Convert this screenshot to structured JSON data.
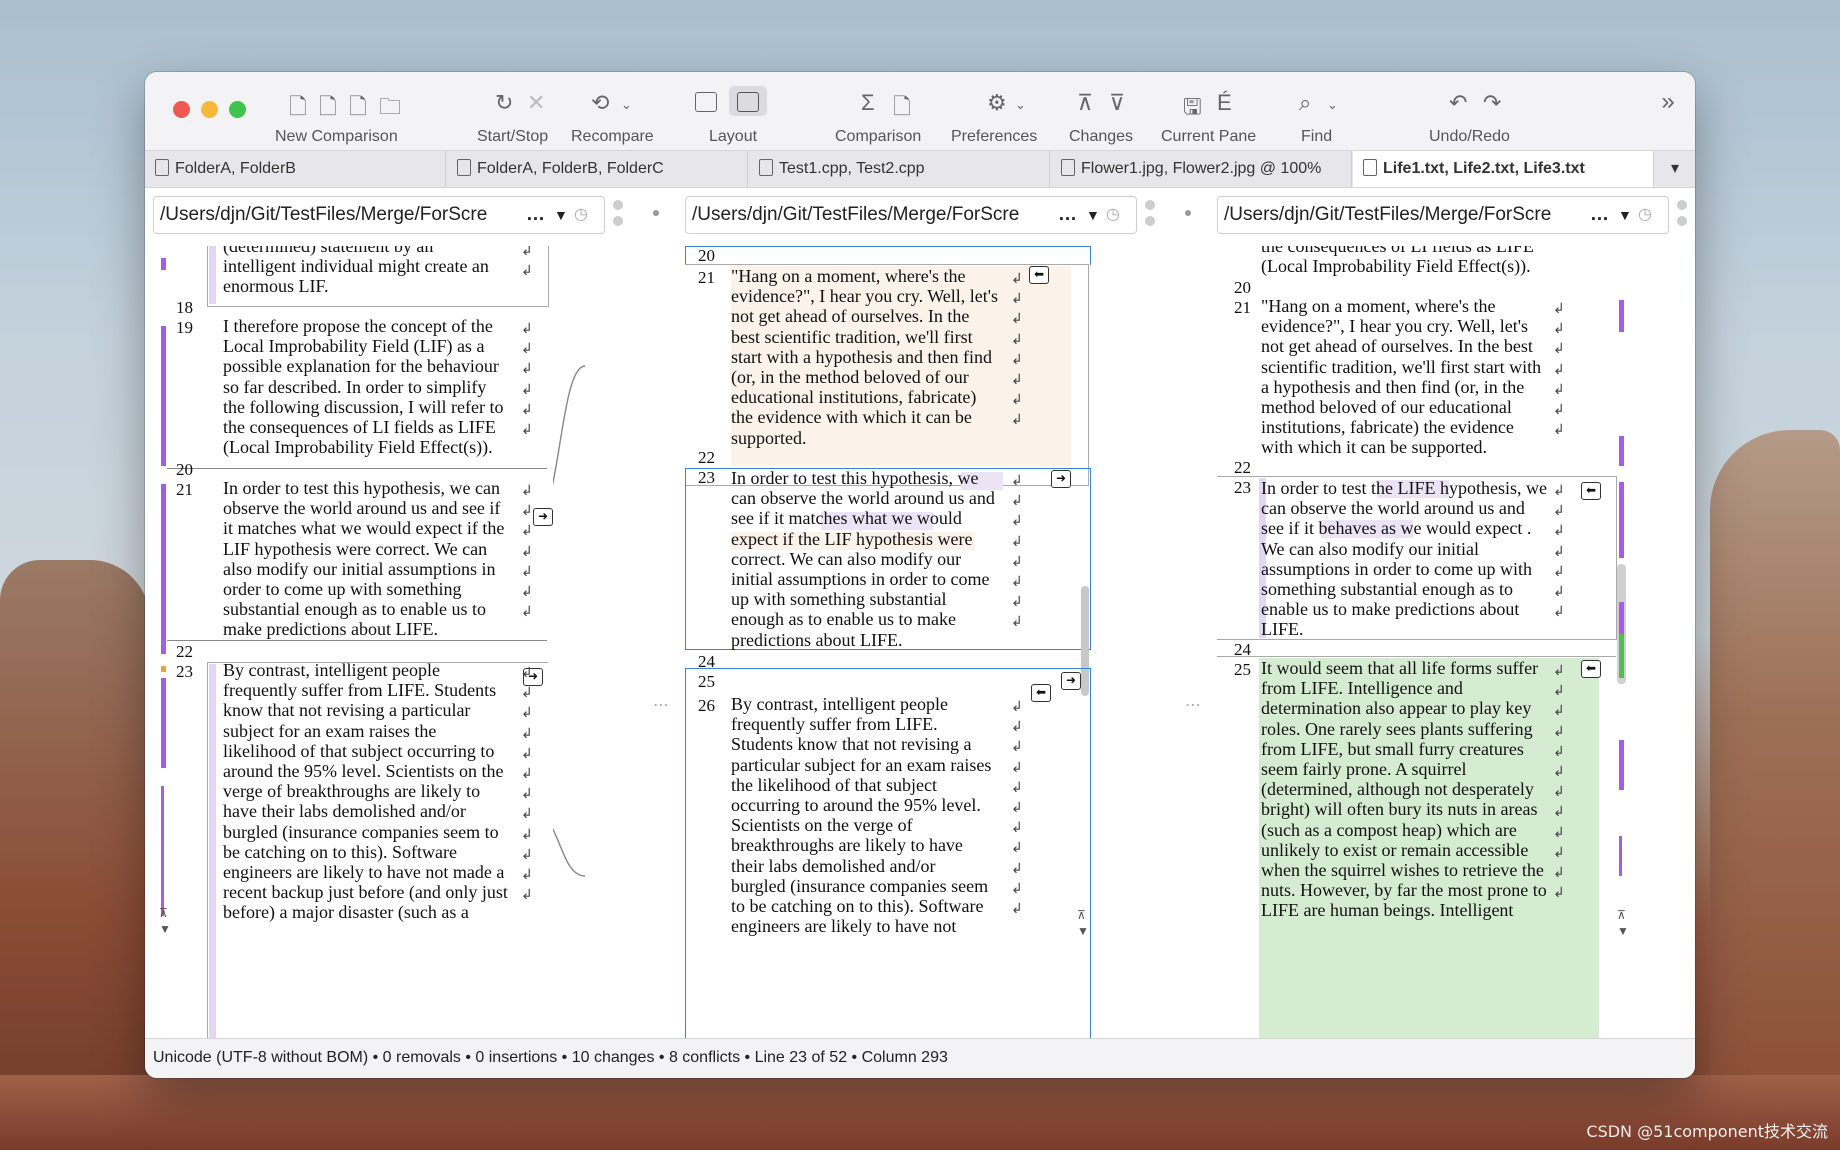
{
  "toolbar": {
    "new_comparison": "New Comparison",
    "start_stop": "Start/Stop",
    "recompare": "Recompare",
    "layout": "Layout",
    "comparison": "Comparison",
    "preferences": "Preferences",
    "changes": "Changes",
    "current_pane": "Current Pane",
    "find": "Find",
    "undo_redo": "Undo/Redo"
  },
  "tabs": [
    {
      "label": "FolderA, FolderB"
    },
    {
      "label": "FolderA, FolderB, FolderC"
    },
    {
      "label": "Test1.cpp, Test2.cpp"
    },
    {
      "label": "Flower1.jpg, Flower2.jpg @ 100%"
    },
    {
      "label": "Life1.txt, Life2.txt, Life3.txt"
    }
  ],
  "paths": {
    "left": "/Users/djn/Git/TestFiles/Merge/ForScre",
    "middle": "/Users/djn/Git/TestFiles/Merge/ForScre",
    "right": "/Users/djn/Git/TestFiles/Merge/ForScre",
    "ellipsis": "…"
  },
  "left_pane": {
    "top_lines": [
      "(determined) statement by an",
      "intelligent individual might create an",
      "enormous LIF."
    ],
    "n18": "18",
    "n19": "19",
    "block19": [
      "I therefore propose the concept of the",
      "Local Improbability Field (LIF) as a",
      "possible explanation for the behaviour",
      "so far described. In order to simplify",
      "the following discussion, I will refer to",
      "the consequences of LI fields as LIFE",
      "(Local Improbability Field Effect(s))."
    ],
    "n20": "20",
    "n21": "21",
    "block21": [
      "In order to test this hypothesis, we can",
      "observe the world around us and see if",
      "it matches what we would expect if the",
      "LIF hypothesis were correct. We can",
      "also modify our initial assumptions in",
      "order to come up with something",
      "substantial enough as to enable us to",
      "make predictions about LIFE."
    ],
    "n22": "22",
    "n23": "23",
    "block23": [
      "By contrast, intelligent people",
      "frequently suffer from LIFE. Students",
      "know that not revising a particular",
      "subject for an exam raises the",
      "likelihood of that subject occurring to",
      "around the 95% level. Scientists on the",
      "verge of breakthroughs are likely to",
      "have their labs demolished and/or",
      "burgled (insurance companies seem to",
      "be catching on to this). Software",
      "engineers are likely to have not made a",
      "recent backup just before (and only just",
      "before) a major disaster  (such as a"
    ]
  },
  "middle_pane": {
    "n20": "20",
    "n21": "21",
    "block21": [
      "\"Hang on a moment, where's the",
      "evidence?\", I hear you cry. Well, let's",
      "not get ahead of ourselves. In the",
      "best scientific tradition, we'll first",
      "start with a hypothesis and then find",
      "(or, in the method beloved of our",
      "educational institutions, fabricate)",
      "the evidence with which it can be",
      "supported."
    ],
    "n22": "22",
    "n23": "23",
    "block23": [
      "In order to test this hypothesis, we",
      "can observe the world around us and",
      "see if it matches what we would",
      "expect if the LIF hypothesis were",
      "correct. We can also modify our",
      "initial assumptions in order to come",
      "up with something substantial",
      "enough as to enable us to make",
      "predictions about LIFE."
    ],
    "n24": "24",
    "n25": "25",
    "n26": "26",
    "block26": [
      "By contrast, intelligent people",
      "frequently suffer from LIFE.",
      "Students know that not revising a",
      "particular subject for an exam raises",
      "the likelihood of that subject",
      "occurring to around the 95% level.",
      "Scientists on the verge of",
      "breakthroughs are likely to have",
      "their labs demolished and/or",
      "burgled (insurance companies seem",
      "to be catching on to this). Software",
      "engineers are likely to have not"
    ]
  },
  "right_pane": {
    "top_lines": [
      "the consequences of LI fields as LIFE",
      "(Local Improbability Field Effect(s))."
    ],
    "n20": "20",
    "n21": "21",
    "block21": [
      "\"Hang on a moment, where's the",
      "evidence?\", I hear you cry. Well, let's",
      "not get ahead of ourselves. In the best",
      "scientific tradition, we'll first start with",
      "a hypothesis and then find (or, in the",
      "method beloved of our educational",
      "institutions, fabricate) the evidence",
      "with which it can be supported."
    ],
    "n22": "22",
    "n23": "23",
    "block23": [
      "In order to test the LIFE hypothesis, we",
      "can observe the world around us and",
      "see if it behaves as we would expect .",
      "We can also modify our initial",
      "assumptions in order to come up with",
      "something substantial enough as to",
      "enable us to make predictions about",
      "LIFE."
    ],
    "n24": "24",
    "n25": "25",
    "block25": [
      "It would seem that all life forms suffer",
      "from LIFE. Intelligence and",
      "determination also appear to play key",
      "roles. One rarely sees plants suffering",
      "from LIFE, but small furry creatures",
      "seem fairly prone. A squirrel",
      "(determined, although not desperately",
      "bright) will often bury its nuts in areas",
      "(such as a compost heap) which are",
      "unlikely to exist or remain accessible",
      "when the squirrel wishes to retrieve the",
      "nuts. However, by far the most prone to",
      "LIFE are human beings. Intelligent"
    ]
  },
  "status": "Unicode (UTF-8 without BOM) • 0 removals • 0 insertions • 10 changes • 8 conflicts • Line 23 of 52 • Column 293",
  "colors": {
    "accent": "#a35de6",
    "change_bg": "#fbf2ea",
    "insert_bg": "#d6ecd2",
    "selection": "#3b82d6"
  },
  "watermark": "CSDN @51component技术交流"
}
